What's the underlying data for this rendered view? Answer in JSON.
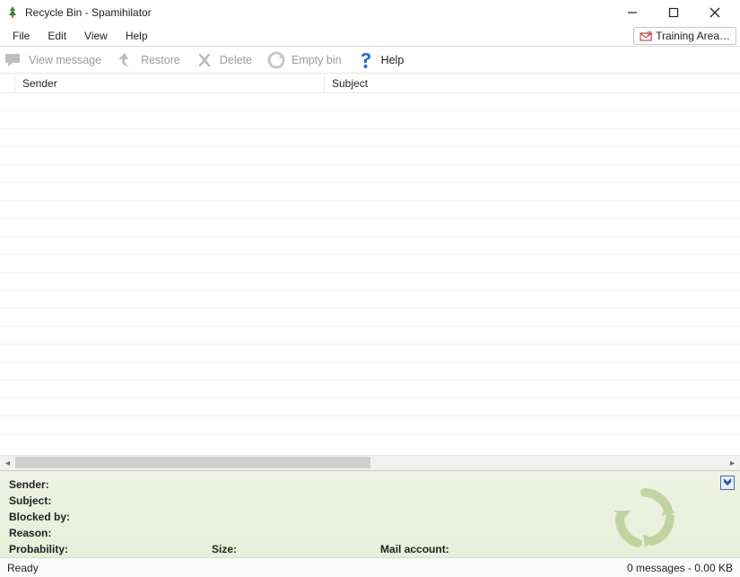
{
  "window": {
    "title": "Recycle Bin - Spamihilator"
  },
  "menu": {
    "items": [
      "File",
      "Edit",
      "View",
      "Help"
    ],
    "training": "Training Area…"
  },
  "toolbar": {
    "view_message": "View message",
    "restore": "Restore",
    "delete": "Delete",
    "empty_bin": "Empty bin",
    "help": "Help"
  },
  "columns": {
    "sender": "Sender",
    "subject": "Subject"
  },
  "details": {
    "sender_label": "Sender:",
    "subject_label": "Subject:",
    "blocked_by_label": "Blocked by:",
    "reason_label": "Reason:",
    "probability_label": "Probability:",
    "size_label": "Size:",
    "mail_account_label": "Mail account:"
  },
  "status": {
    "ready": "Ready",
    "summary": "0 messages - 0.00 KB"
  }
}
